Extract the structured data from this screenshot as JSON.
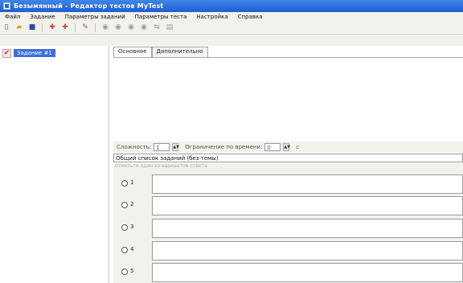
{
  "window": {
    "title": "Безымянный - Редактор тестов MyTest"
  },
  "menu": [
    "Файл",
    "Задание",
    "Параметры заданий",
    "Параметры теста",
    "Настройка",
    "Справка"
  ],
  "toolbar": {
    "icons": [
      "new-file-icon",
      "open-folder-icon",
      "save-icon",
      "add-task-icon",
      "add-task-copy-icon",
      "task-settings-icon",
      "circle-prev-icon",
      "circle-next-icon",
      "circle-up-icon",
      "circle-down-icon",
      "move-icon",
      "properties-icon"
    ]
  },
  "tree": {
    "task_label": "Задание #1"
  },
  "tabs": [
    "Основное",
    "Дополнительно"
  ],
  "settings": {
    "difficulty_label": "Сложность:",
    "difficulty_value": "1",
    "time_label": "Ограничение по времени:",
    "time_value": "0",
    "time_unit": "с"
  },
  "list": {
    "selected": "Общий список заданий (без темы)"
  },
  "hint": "отметьте один из вариантов ответа",
  "answers": [
    "1",
    "2",
    "3",
    "4",
    "5"
  ]
}
